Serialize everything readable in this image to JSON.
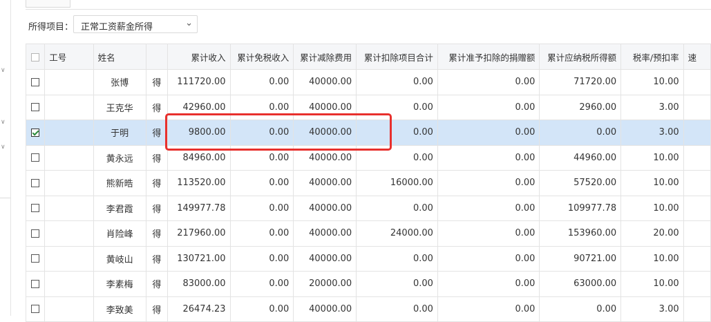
{
  "filter": {
    "label": "所得项目：",
    "selected": "常工资薪金所得",
    "select_prefix": "正"
  },
  "table": {
    "headers": {
      "id": "工号",
      "name": "姓名",
      "action": "",
      "income": "累计收入",
      "tax_free": "累计免税收入",
      "deduction_fee": "累计减除费用",
      "special_total": "累计扣除项目合计",
      "donation": "累计准予扣除的捐赠额",
      "taxable": "累计应纳税所得额",
      "rate": "税率/预扣率",
      "quick": "速"
    },
    "rows": [
      {
        "checked": false,
        "id": "",
        "name": "张博",
        "action": "得",
        "income": "111720.00",
        "tax_free": "0.00",
        "deduction_fee": "40000.00",
        "special_total": "0.00",
        "donation": "0.00",
        "taxable": "71720.00",
        "rate": "10.00",
        "quick": ""
      },
      {
        "checked": false,
        "id": "",
        "name": "王克华",
        "action": "得",
        "income": "42960.00",
        "tax_free": "0.00",
        "deduction_fee": "40000.00",
        "special_total": "0.00",
        "donation": "0.00",
        "taxable": "2960.00",
        "rate": "3.00",
        "quick": ""
      },
      {
        "checked": true,
        "id": "",
        "name": "于明",
        "action": "得",
        "income": "9800.00",
        "tax_free": "0.00",
        "deduction_fee": "40000.00",
        "special_total": "0.00",
        "donation": "0.00",
        "taxable": "0.00",
        "rate": "3.00",
        "quick": ""
      },
      {
        "checked": false,
        "id": "",
        "name": "黄永远",
        "action": "得",
        "income": "84960.00",
        "tax_free": "0.00",
        "deduction_fee": "40000.00",
        "special_total": "0.00",
        "donation": "0.00",
        "taxable": "44960.00",
        "rate": "10.00",
        "quick": ""
      },
      {
        "checked": false,
        "id": "",
        "name": "熊新晧",
        "action": "得",
        "income": "113520.00",
        "tax_free": "0.00",
        "deduction_fee": "40000.00",
        "special_total": "16000.00",
        "donation": "0.00",
        "taxable": "57520.00",
        "rate": "10.00",
        "quick": ""
      },
      {
        "checked": false,
        "id": "",
        "name": "李君霞",
        "action": "得",
        "income": "149977.78",
        "tax_free": "0.00",
        "deduction_fee": "40000.00",
        "special_total": "0.00",
        "donation": "0.00",
        "taxable": "109977.78",
        "rate": "10.00",
        "quick": ""
      },
      {
        "checked": false,
        "id": "",
        "name": "肖险峰",
        "action": "得",
        "income": "217960.00",
        "tax_free": "0.00",
        "deduction_fee": "40000.00",
        "special_total": "24000.00",
        "donation": "0.00",
        "taxable": "153960.00",
        "rate": "20.00",
        "quick": ""
      },
      {
        "checked": false,
        "id": "",
        "name": "黄岐山",
        "action": "得",
        "income": "130721.00",
        "tax_free": "0.00",
        "deduction_fee": "40000.00",
        "special_total": "0.00",
        "donation": "0.00",
        "taxable": "90721.00",
        "rate": "10.00",
        "quick": ""
      },
      {
        "checked": false,
        "id": "",
        "name": "李素梅",
        "action": "得",
        "income": "83000.00",
        "tax_free": "0.00",
        "deduction_fee": "20000.00",
        "special_total": "0.00",
        "donation": "0.00",
        "taxable": "63000.00",
        "rate": "10.00",
        "quick": ""
      },
      {
        "checked": false,
        "id": "",
        "name": "李致美",
        "action": "得",
        "income": "26474.23",
        "tax_free": "0.00",
        "deduction_fee": "40000.00",
        "special_total": "0.00",
        "donation": "0.00",
        "taxable": "0.00",
        "rate": "3.00",
        "quick": ""
      }
    ]
  },
  "colors": {
    "selected_row": "#d3e5f8",
    "highlight_border": "#e8302d",
    "header_bg": "#f5f6f8"
  },
  "icons": {
    "collapse_chevrons": "chevron-down-icon",
    "dropdown_arrow": "chevron-down-icon"
  }
}
